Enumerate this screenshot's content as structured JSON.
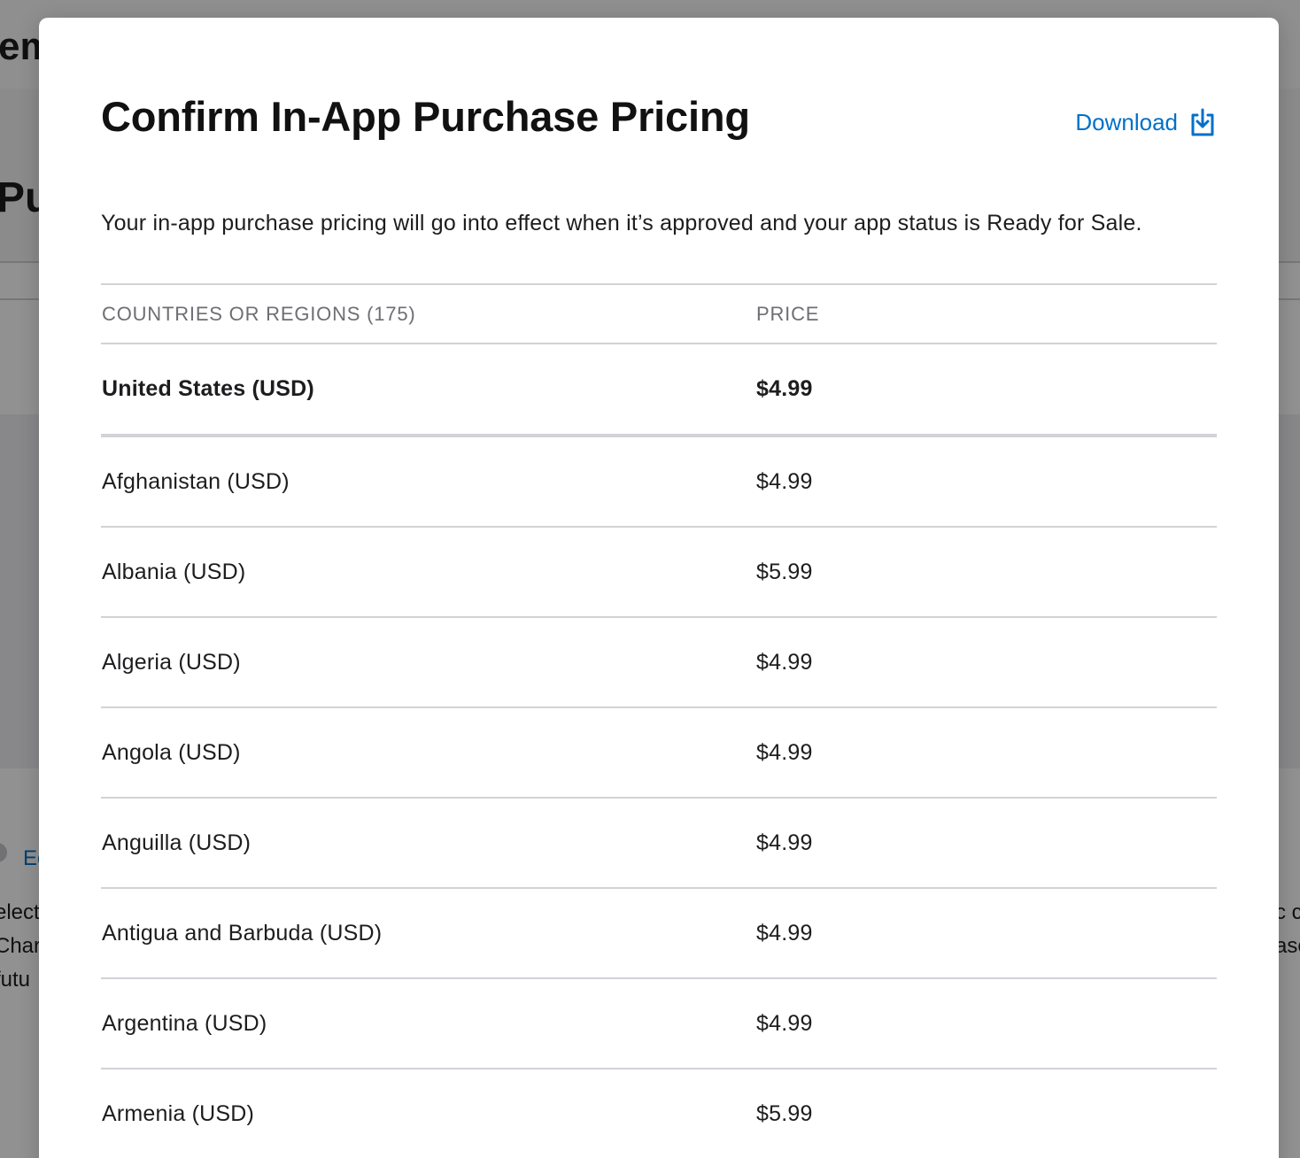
{
  "background": {
    "heading_fragment": "em",
    "title_fragment": "Pu",
    "edit_link_fragment": "Ec",
    "left_text_lines": [
      "elect",
      "Char",
      "futu"
    ],
    "right_text_lines": [
      "c c",
      "ase"
    ]
  },
  "modal": {
    "title": "Confirm In-App Purchase Pricing",
    "download_label": "Download",
    "download_icon": "download-tray-icon",
    "description": "Your in-app purchase pricing will go into effect when it’s approved and your app status is Ready for Sale.",
    "table": {
      "headers": {
        "country": "COUNTRIES OR REGIONS (175)",
        "price": "PRICE"
      },
      "featured_row": {
        "country": "United States (USD)",
        "price": "$4.99"
      },
      "rows": [
        {
          "country": "Afghanistan (USD)",
          "price": "$4.99"
        },
        {
          "country": "Albania (USD)",
          "price": "$5.99"
        },
        {
          "country": "Algeria (USD)",
          "price": "$4.99"
        },
        {
          "country": "Angola (USD)",
          "price": "$4.99"
        },
        {
          "country": "Anguilla (USD)",
          "price": "$4.99"
        },
        {
          "country": "Antigua and Barbuda (USD)",
          "price": "$4.99"
        },
        {
          "country": "Argentina (USD)",
          "price": "$4.99"
        },
        {
          "country": "Armenia (USD)",
          "price": "$5.99"
        }
      ]
    }
  },
  "colors": {
    "accent": "#0070c9",
    "text": "#1d1d1f",
    "muted": "#6e6e73",
    "divider": "#d2d2d7"
  }
}
